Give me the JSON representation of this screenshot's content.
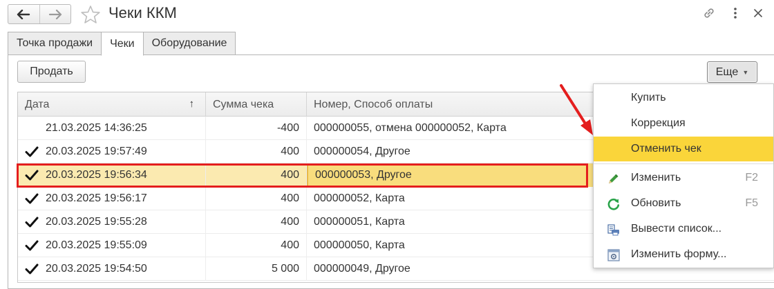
{
  "window": {
    "title": "Чеки ККМ",
    "icons": [
      "back-arrow-icon",
      "forward-arrow-icon",
      "star-icon",
      "link-icon",
      "more-vertical-icon",
      "close-icon"
    ]
  },
  "tabs": [
    {
      "label": "Точка продажи",
      "active": false
    },
    {
      "label": "Чеки",
      "active": true
    },
    {
      "label": "Оборудование",
      "active": false
    }
  ],
  "toolbar": {
    "sell_label": "Продать",
    "more_label": "Еще"
  },
  "table": {
    "columns": [
      "Дата",
      "Сумма чека",
      "Номер, Способ оплаты"
    ],
    "sort_indicator": "↑",
    "rows": [
      {
        "date": "21.03.2025 14:36:25",
        "sum": "-400",
        "info": "000000055, отмена 000000052, Карта",
        "checked": false
      },
      {
        "date": "20.03.2025 19:57:49",
        "sum": "400",
        "info": "000000054, Другое",
        "checked": true
      },
      {
        "date": "20.03.2025 19:56:34",
        "sum": "400",
        "info": "000000053, Другое",
        "checked": true,
        "selected": true
      },
      {
        "date": "20.03.2025 19:56:17",
        "sum": "400",
        "info": "000000052, Карта",
        "checked": true
      },
      {
        "date": "20.03.2025 19:55:28",
        "sum": "400",
        "info": "000000051, Карта",
        "checked": true
      },
      {
        "date": "20.03.2025 19:55:09",
        "sum": "400",
        "info": "000000050, Карта",
        "checked": true
      },
      {
        "date": "20.03.2025 19:54:50",
        "sum": "5 000",
        "info": "000000049, Другое",
        "checked": true
      }
    ]
  },
  "menu": {
    "items": [
      {
        "label": "Купить",
        "icon": "",
        "shortcut": ""
      },
      {
        "label": "Коррекция",
        "icon": "",
        "shortcut": ""
      },
      {
        "label": "Отменить чек",
        "icon": "",
        "shortcut": "",
        "active": true
      },
      {
        "label": "Изменить",
        "icon": "pencil-icon",
        "shortcut": "F2"
      },
      {
        "label": "Обновить",
        "icon": "refresh-icon",
        "shortcut": "F5"
      },
      {
        "label": "Вывести список...",
        "icon": "print-list-icon",
        "shortcut": ""
      },
      {
        "label": "Изменить форму...",
        "icon": "form-settings-icon",
        "shortcut": ""
      }
    ]
  },
  "colors": {
    "selected_row": "#fbeab0",
    "menu_active": "#fad53a",
    "annotation_red": "#e41e1e",
    "refresh_green": "#2aa34a"
  }
}
